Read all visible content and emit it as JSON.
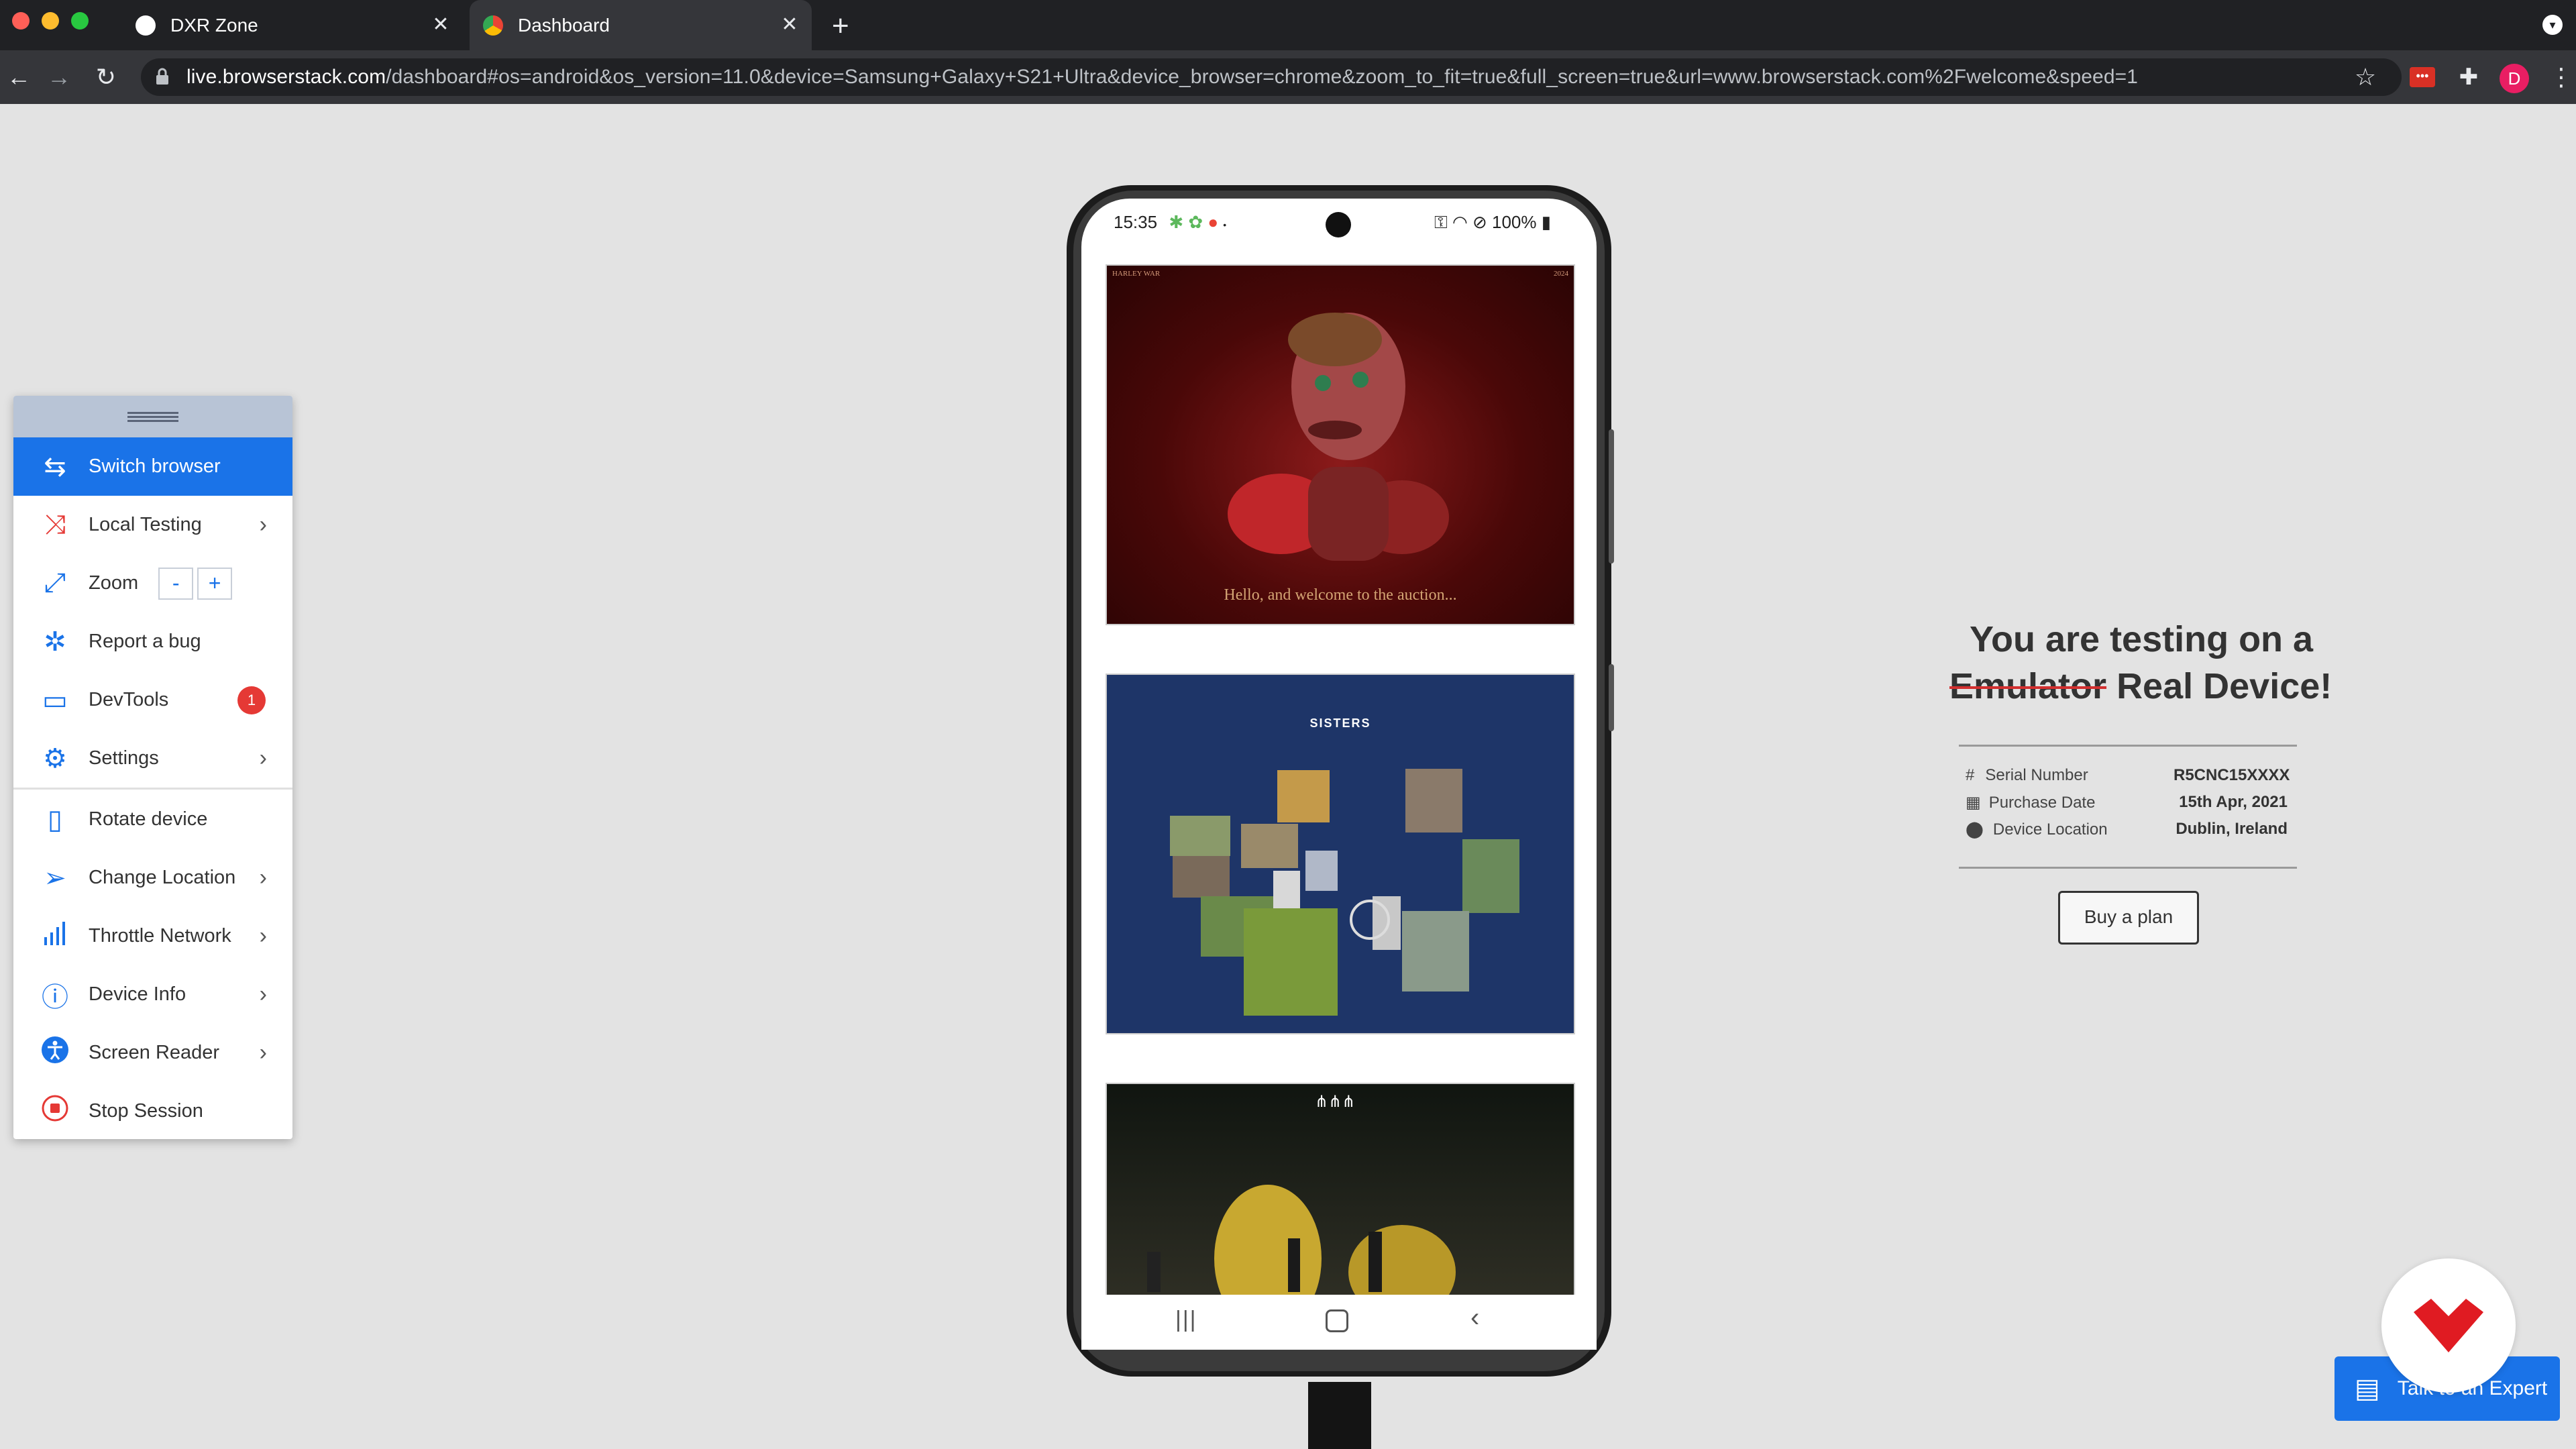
{
  "browser": {
    "tabs": [
      {
        "label": "DXR Zone",
        "active": false
      },
      {
        "label": "Dashboard",
        "active": true
      }
    ],
    "new_tab_label": "+",
    "url_host": "live.browserstack.com",
    "url_path": "/dashboard#os=android&os_version=11.0&device=Samsung+Galaxy+S21+Ultra&device_browser=chrome&zoom_to_fit=true&full_screen=true&url=www.browserstack.com%2Fwelcome&speed=1",
    "profile_initial": "D",
    "colors": {
      "accent": "#1a73e8",
      "dark": "#202124",
      "toolbar": "#35363a"
    }
  },
  "panel": {
    "items": [
      {
        "label": "Switch browser",
        "icon": "switch-icon",
        "active": true
      },
      {
        "label": "Local Testing",
        "icon": "local-testing-icon",
        "chevron": true
      },
      {
        "label": "Zoom",
        "icon": "zoom-icon",
        "minus": "-",
        "plus": "+"
      },
      {
        "label": "Report a bug",
        "icon": "bug-icon"
      },
      {
        "label": "DevTools",
        "icon": "devtools-icon",
        "badge": "1"
      },
      {
        "label": "Settings",
        "icon": "gear-icon",
        "chevron": true
      },
      {
        "label": "Rotate device",
        "icon": "rotate-icon"
      },
      {
        "label": "Change Location",
        "icon": "location-arrow-icon",
        "chevron": true
      },
      {
        "label": "Throttle Network",
        "icon": "signal-icon",
        "chevron": true
      },
      {
        "label": "Device Info",
        "icon": "info-icon",
        "chevron": true
      },
      {
        "label": "Screen Reader",
        "icon": "accessibility-icon",
        "chevron": true
      },
      {
        "label": "Stop Session",
        "icon": "stop-icon"
      }
    ]
  },
  "phone": {
    "time": "15:35",
    "battery": "100%",
    "frames": [
      {
        "caption": "Hello, and welcome to the auction...",
        "header_left": "HARLEY WAR",
        "header_right": "2024"
      },
      {
        "title": "SISTERS"
      },
      {
        "title": ""
      }
    ]
  },
  "info": {
    "headline_line1": "You are testing on a",
    "headline_strike": "Emulator",
    "headline_rest": "Real Device!",
    "rows": [
      {
        "icon": "hash-icon",
        "key": "Serial Number",
        "value": "R5CNC15XXXX"
      },
      {
        "icon": "calendar-icon",
        "key": "Purchase Date",
        "value": "15th Apr, 2021"
      },
      {
        "icon": "pin-icon",
        "key": "Device Location",
        "value": "Dublin, Ireland"
      }
    ],
    "buy_label": "Buy a plan"
  },
  "chat": {
    "label": "Talk to an Expert"
  }
}
